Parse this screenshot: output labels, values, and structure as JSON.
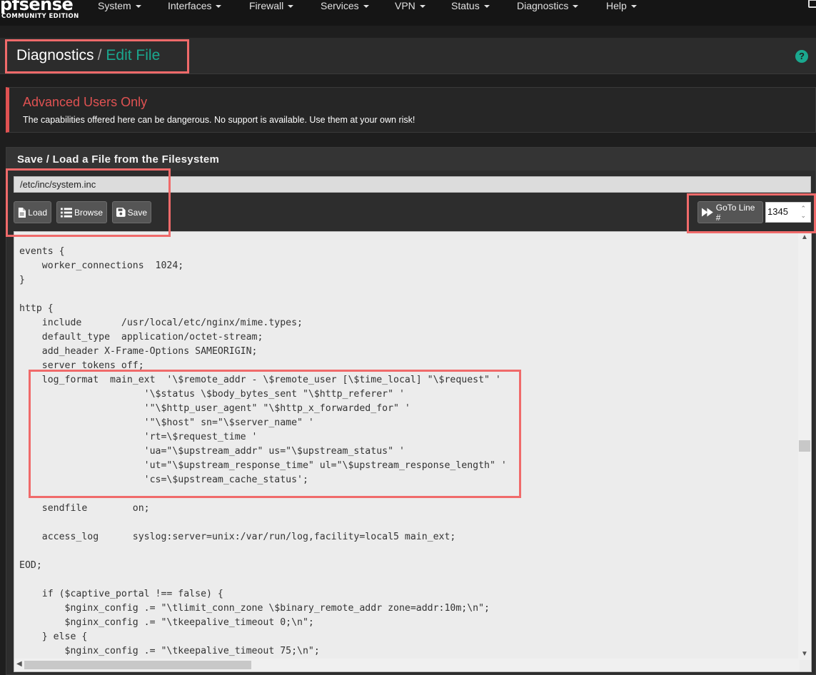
{
  "navbar": {
    "logo_main": "pfsense",
    "logo_sub": "COMMUNITY EDITION",
    "menu": [
      "System",
      "Interfaces",
      "Firewall",
      "Services",
      "VPN",
      "Status",
      "Diagnostics",
      "Help"
    ]
  },
  "breadcrumb": {
    "section": "Diagnostics",
    "separator": "/",
    "page": "Edit File"
  },
  "help_icon": {
    "glyph": "?"
  },
  "alert": {
    "title": "Advanced Users Only",
    "text": "The capabilities offered here can be dangerous. No support is available. Use them at your own risk!"
  },
  "panel": {
    "title": "Save / Load a File from the Filesystem"
  },
  "file": {
    "path": "/etc/inc/system.inc",
    "buttons": {
      "load": "Load",
      "browse": "Browse",
      "save": "Save",
      "goto": "GoTo Line #"
    },
    "line_number": "1345"
  },
  "editor": {
    "lines": [
      "events {",
      "    worker_connections  1024;",
      "}",
      "",
      "http {",
      "    include       /usr/local/etc/nginx/mime.types;",
      "    default_type  application/octet-stream;",
      "    add_header X-Frame-Options SAMEORIGIN;",
      "    server_tokens off;",
      "    log_format  main_ext  '\\$remote_addr - \\$remote_user [\\$time_local] \"\\$request\" '",
      "                      '\\$status \\$body_bytes_sent \"\\$http_referer\" '",
      "                      '\"\\$http_user_agent\" \"\\$http_x_forwarded_for\" '",
      "                      '\"\\$host\" sn=\"\\$server_name\" '",
      "                      'rt=\\$request_time '",
      "                      'ua=\"\\$upstream_addr\" us=\"\\$upstream_status\" '",
      "                      'ut=\"\\$upstream_response_time\" ul=\"\\$upstream_response_length\" '",
      "                      'cs=\\$upstream_cache_status';",
      "",
      "    sendfile        on;",
      "",
      "    access_log      syslog:server=unix:/var/run/log,facility=local5 main_ext;",
      "",
      "EOD;",
      "",
      "    if ($captive_portal !== false) {",
      "        $nginx_config .= \"\\tlimit_conn_zone \\$binary_remote_addr zone=addr:10m;\\n\";",
      "        $nginx_config .= \"\\tkeepalive_timeout 0;\\n\";",
      "    } else {",
      "        $nginx_config .= \"\\tkeepalive_timeout 75;\\n\";"
    ]
  },
  "colors": {
    "accent": "#1aa88f",
    "danger": "#e05252",
    "highlight": "#f06a6a"
  }
}
